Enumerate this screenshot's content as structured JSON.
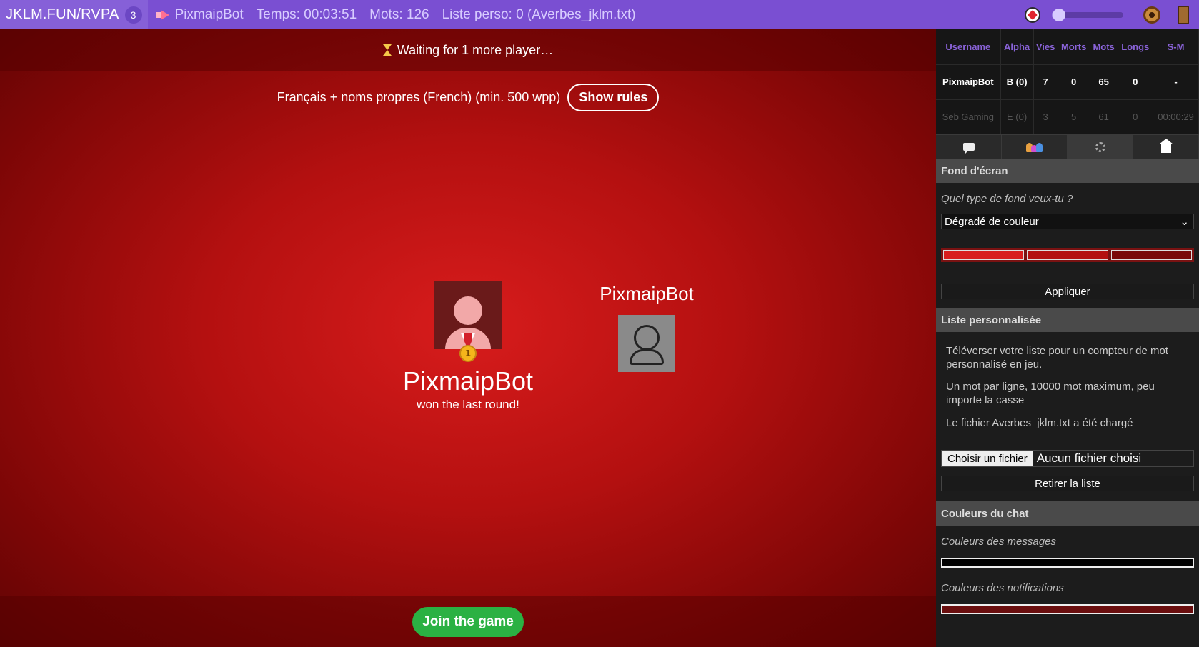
{
  "topbar": {
    "room_code": "JKLM.FUN/RVPA",
    "room_count": "3",
    "player_name": "PixmaipBot",
    "temps": "Temps: 00:03:51",
    "mots": "Mots: 126",
    "liste": "Liste perso: 0 (Averbes_jklm.txt)",
    "volume": 0.05,
    "icons": [
      "megaphone-icon",
      "mute-icon",
      "donut-icon",
      "door-icon"
    ]
  },
  "stage": {
    "waiting": "Waiting for 1 more player…",
    "rules_text": "Français + noms propres (French) (min. 500 wpp)",
    "show_rules": "Show rules",
    "winner_name": "PixmaipBot",
    "winner_sub": "won the last round!",
    "medal_number": "1",
    "player2_name": "PixmaipBot",
    "join": "Join the game",
    "background_colors": [
      "#d81c1c",
      "#b41010",
      "#600404"
    ]
  },
  "stats": {
    "headers": [
      "Username",
      "Alpha",
      "Vies",
      "Morts",
      "Mots",
      "Longs",
      "S-M"
    ],
    "rows": [
      [
        "PixmaipBot",
        "B (0)",
        "7",
        "0",
        "65",
        "0",
        "-"
      ],
      [
        "Seb Gaming",
        "E (0)",
        "3",
        "5",
        "61",
        "0",
        "00:00:29"
      ]
    ]
  },
  "sidebar": {
    "tabs": [
      "chat-tab",
      "players-tab",
      "settings-tab",
      "home-tab"
    ],
    "fond_title": "Fond d'écran",
    "fond_question": "Quel type de fond veux-tu ?",
    "fond_select": "Dégradé de couleur",
    "gradient_colors": [
      "#d81c1c",
      "#b41010",
      "#7a0808"
    ],
    "apply": "Appliquer",
    "liste_title": "Liste personnalisée",
    "liste_p1": "Téléverser votre liste pour un compteur de mot personnalisé en jeu.",
    "liste_p2": "Un mot par ligne, 10000 mot maximum, peu importe la casse",
    "liste_p3": "Le fichier Averbes_jklm.txt a été chargé",
    "file_button": "Choisir un fichier",
    "file_text": "Aucun fichier choisi",
    "remove": "Retirer la liste",
    "chat_title": "Couleurs du chat",
    "msg_colors": "Couleurs des messages",
    "notif_colors": "Couleurs des notifications"
  }
}
